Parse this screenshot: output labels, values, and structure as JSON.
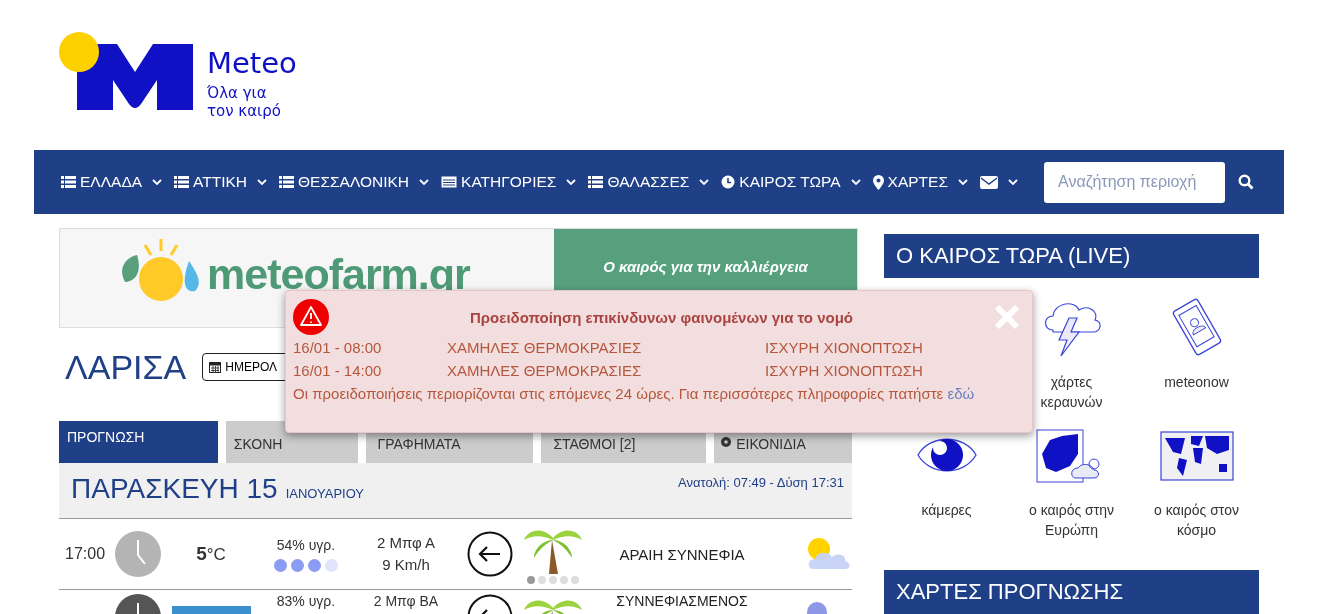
{
  "logo": {
    "name": "Meteo",
    "tagline_1": "Όλα για",
    "tagline_2": "τον καιρό"
  },
  "nav": {
    "items": [
      {
        "label": "ΕΛΛΑΔΑ",
        "kind": "list"
      },
      {
        "label": "ΑΤΤΙΚΗ",
        "kind": "list"
      },
      {
        "label": "ΘΕΣΣΑΛΟΝΙΚΗ",
        "kind": "list"
      },
      {
        "label": "ΚΑΤΗΓΟΡΙΕΣ",
        "kind": "table"
      },
      {
        "label": "ΘΑΛΑΣΣΕΣ",
        "kind": "list"
      },
      {
        "label": "ΚΑΙΡΟΣ ΤΩΡΑ",
        "kind": "clock"
      },
      {
        "label": "ΧΑΡΤΕΣ",
        "kind": "pin"
      },
      {
        "kind": "mail"
      }
    ],
    "search": {
      "placeholder": "Αναζήτηση περιοχή"
    }
  },
  "banner": {
    "brand": "meteofarm.gr",
    "slogan": "Ο καιρός για την καλλιέργεια"
  },
  "city": {
    "name": "ΛΑΡΙΣΑ",
    "calendar_button": "ΗΜΕΡΟΛ"
  },
  "tabs": [
    {
      "label": "ΠΡΟΓΝΩΣΗ",
      "selected": true
    },
    {
      "label": "ΣΚΟΝΗ",
      "selected": false
    },
    {
      "label": "ΓΡΑΦΗΜΑΤΑ",
      "selected": false
    },
    {
      "label": "ΣΤΑΘΜΟΙ [2]",
      "selected": false
    },
    {
      "label": "ΕΙΚΟΝΙΔΙΑ",
      "selected": false
    }
  ],
  "day": {
    "weekday": "ΠΑΡΑΣΚΕΥΗ 15",
    "month": "ΙΑΝΟΥΑΡΙΟΥ",
    "sun": "Ανατολή: 07:49  - Δύση 17:31"
  },
  "forecast": [
    {
      "time": "17:00",
      "night": false,
      "temp": "5",
      "unit": "°C",
      "humidity": {
        "text": "54% υγρ.",
        "level": 0.75
      },
      "wind_1": "2 Μπφ Α",
      "wind_2": "9 Km/h",
      "wind_scale": {
        "level": 0.2
      },
      "sky": "ΑΡΑΙΗ ΣΥΝΝΕΦΙΑ"
    },
    {
      "night": true,
      "humidity": {
        "text": "83% υγρ."
      },
      "wind_1": "2 Μπφ ΒΑ",
      "sky": "ΣΥΝΝΕΦΙΑΣΜΕΝΟΣ"
    }
  ],
  "live": {
    "title": "Ο ΚΑΙΡΟΣ ΤΩΡΑ (LIVE)",
    "items": [
      {
        "label": "χάρτες κεραυνών",
        "kind": "lightning"
      },
      {
        "label": "meteonow",
        "kind": "tablet"
      },
      {
        "label": "κάμερες",
        "kind": "eye"
      },
      {
        "label": "ο καιρός στην Ευρώπη",
        "kind": "europe"
      },
      {
        "label": "ο καιρός στον κόσμο",
        "kind": "world"
      }
    ]
  },
  "maps": {
    "title": "ΧΑΡΤΕΣ ΠΡΟΓΝΩΣΗΣ"
  },
  "alert": {
    "title": "Προειδοποίηση επικίνδυνων φαινομένων για το νομό",
    "rows": [
      {
        "date": "16/01 - 08:00",
        "warning_1": "ΧΑΜΗΛΕΣ ΘΕΡΜΟΚΡΑΣΙΕΣ",
        "warning_2": "ΙΣΧΥΡΗ ΧΙΟΝΟΠΤΩΣΗ"
      },
      {
        "date": "16/01 - 14:00",
        "warning_1": "ΧΑΜΗΛΕΣ ΘΕΡΜΟΚΡΑΣΙΕΣ",
        "warning_2": "ΙΣΧΥΡΗ ΧΙΟΝΟΠΤΩΣΗ"
      }
    ],
    "note": "Οι προειδοποιήσεις περιορίζονται στις επόμενες 24 ώρες. Για περισσότερες πληροφορίες πατήστε",
    "link": "εδώ"
  }
}
